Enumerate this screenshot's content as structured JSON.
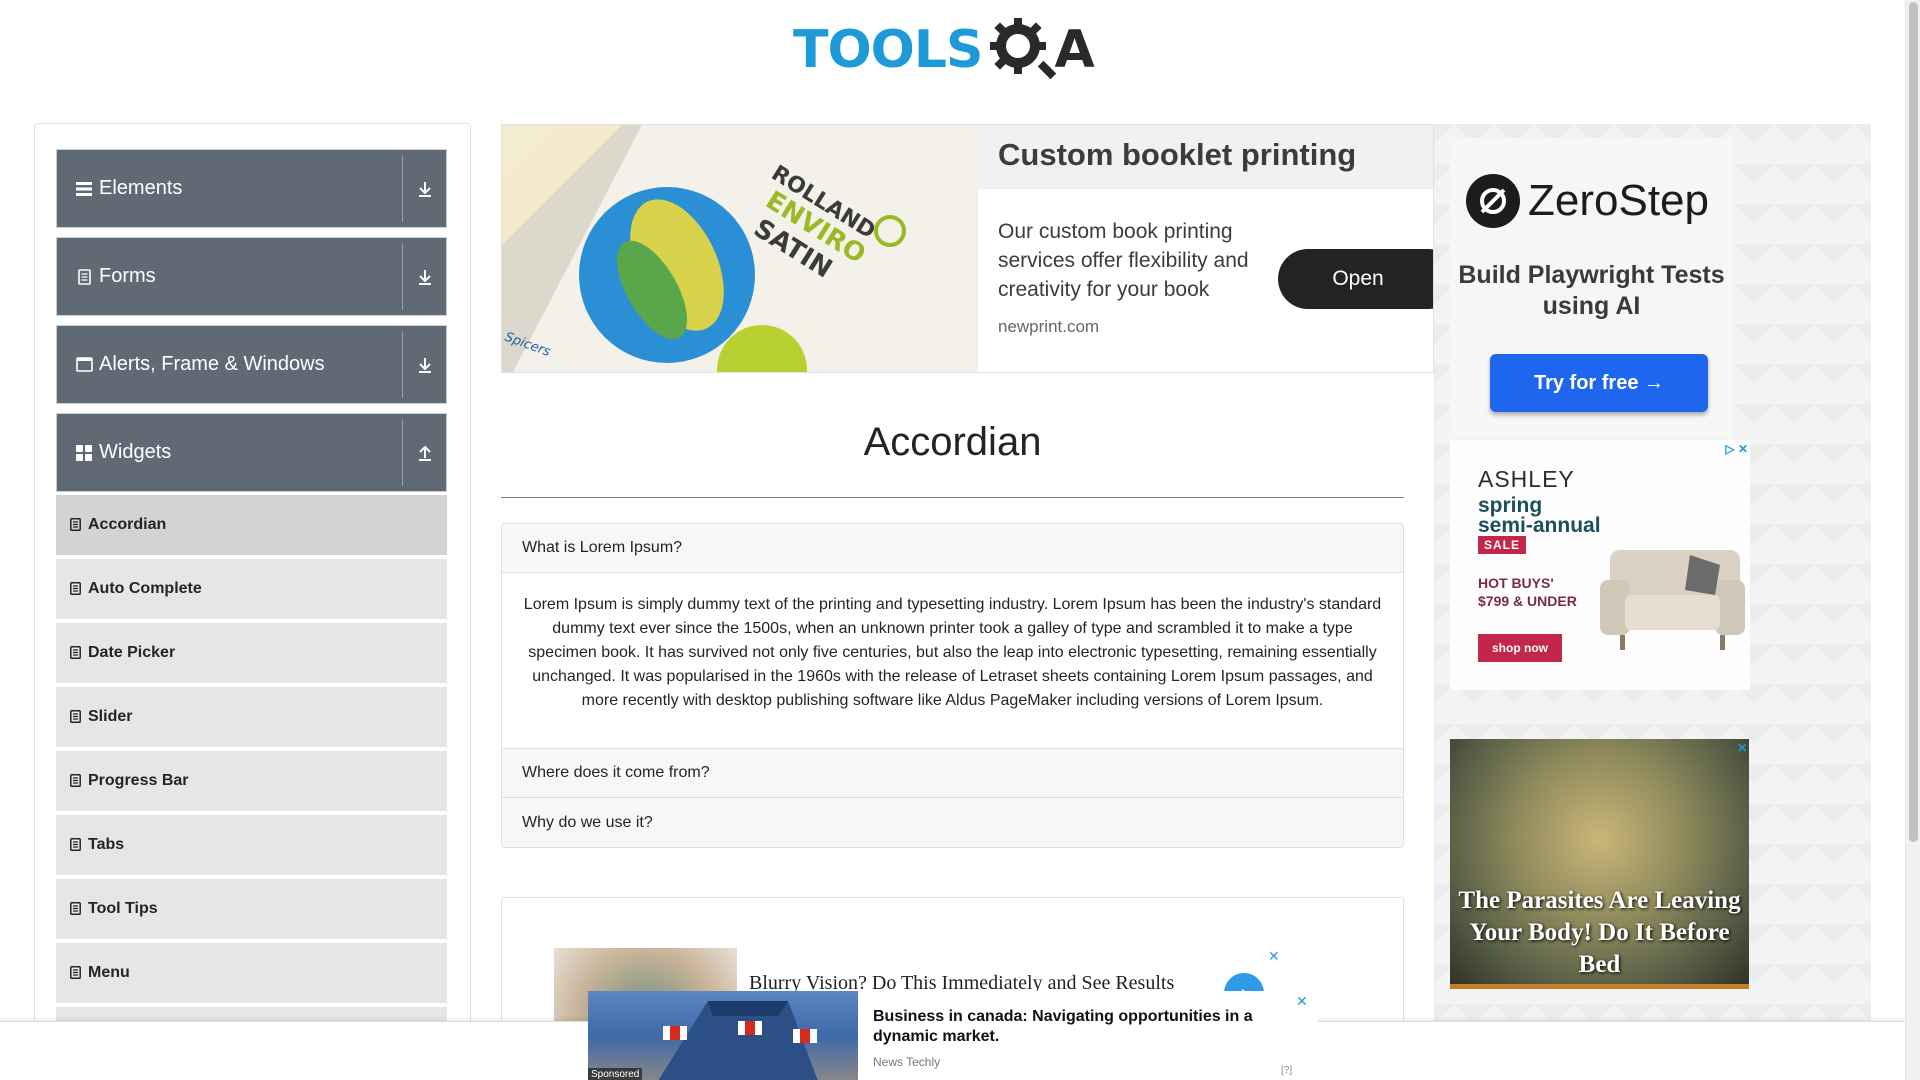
{
  "header": {
    "logo_main": "TOOLS",
    "logo_end": "A"
  },
  "sidebar": {
    "groups": [
      {
        "label": "Elements",
        "icon": "hamburger-icon",
        "expanded": false
      },
      {
        "label": "Forms",
        "icon": "document-icon",
        "expanded": false
      },
      {
        "label": "Alerts, Frame & Windows",
        "icon": "window-icon",
        "expanded": false
      },
      {
        "label": "Widgets",
        "icon": "grid-icon",
        "expanded": true
      }
    ],
    "items": [
      {
        "label": "Accordian",
        "active": true
      },
      {
        "label": "Auto Complete",
        "active": false
      },
      {
        "label": "Date Picker",
        "active": false
      },
      {
        "label": "Slider",
        "active": false
      },
      {
        "label": "Progress Bar",
        "active": false
      },
      {
        "label": "Tabs",
        "active": false
      },
      {
        "label": "Tool Tips",
        "active": false
      },
      {
        "label": "Menu",
        "active": false
      }
    ]
  },
  "top_ad": {
    "title": "Custom booklet printing",
    "description": "Our custom book printing services offer flexibility and creativity for your book",
    "domain": "newprint.com",
    "button": "Open",
    "image_text_1": "ROLLAND",
    "image_text_2": "ENVIRO",
    "image_text_3": "SATIN",
    "image_text_4": "Spicers"
  },
  "main": {
    "title": "Accordian",
    "sections": [
      {
        "heading": "What is Lorem Ipsum?",
        "expanded": true,
        "body": "Lorem Ipsum is simply dummy text of the printing and typesetting industry. Lorem Ipsum has been the industry's standard dummy text ever since the 1500s, when an unknown printer took a galley of type and scrambled it to make a type specimen book. It has survived not only five centuries, but also the leap into electronic typesetting, remaining essentially unchanged. It was popularised in the 1960s with the release of Letraset sheets containing Lorem Ipsum passages, and more recently with desktop publishing software like Aldus PageMaker including versions of Lorem Ipsum."
      },
      {
        "heading": "Where does it come from?",
        "expanded": false
      },
      {
        "heading": "Why do we use it?",
        "expanded": false
      }
    ]
  },
  "bottom_ad": {
    "text": "Blurry Vision? Do This Immediately and See Results",
    "close": "✕",
    "go": "›"
  },
  "right_ads": {
    "zerostep": {
      "name": "ZeroStep",
      "tagline": "Build Playwright Tests using AI",
      "button": "Try for free →"
    },
    "ashley": {
      "brand": "ASHLEY",
      "line1": "spring",
      "line2": "semi-annual",
      "sale": "SALE",
      "hot1": "HOT BUYS'",
      "hot2": "$799 & UNDER",
      "button": "shop now",
      "adchoice": "▷ ✕"
    },
    "parasite": {
      "text": "The Parasites Are Leaving Your Body! Do It Before Bed",
      "close": "✕"
    }
  },
  "sticky_ad": {
    "title": "Business in canada: Navigating opportunities in a dynamic market.",
    "source": "News Techly",
    "sponsored": "Sponsored",
    "close": "✕",
    "info": "[?]"
  },
  "colors": {
    "accent": "#1e9bd7",
    "sidebar_header": "#5f6a74",
    "menu_item": "#e6e6e6"
  }
}
